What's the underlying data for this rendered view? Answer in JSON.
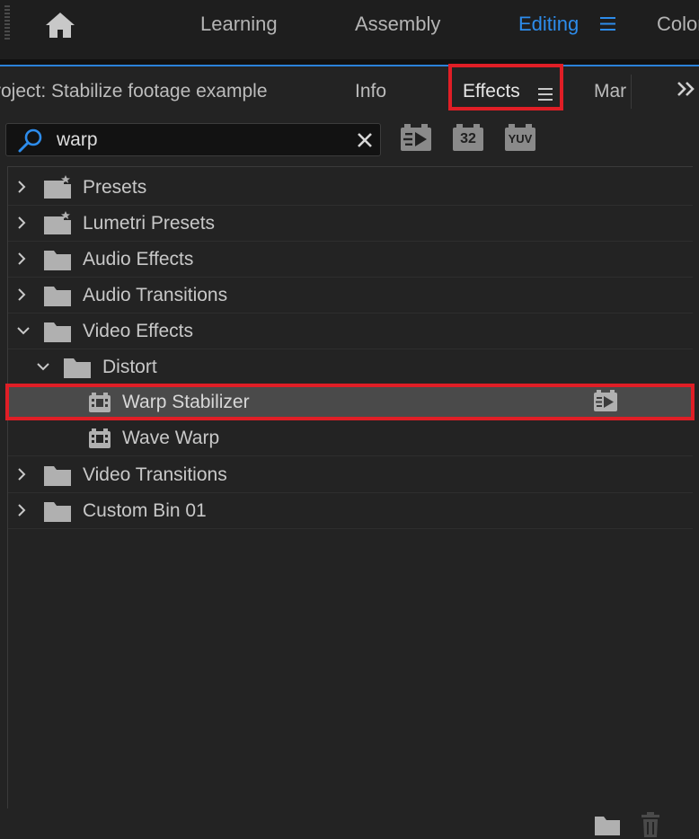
{
  "workspace": {
    "tabs": [
      "Learning",
      "Assembly",
      "Editing",
      "Color"
    ],
    "active": "Editing"
  },
  "panel": {
    "tabs": [
      "roject: Stabilize footage example",
      "Info",
      "Effects",
      "Mar"
    ],
    "active": "Effects"
  },
  "search": {
    "value": "warp",
    "placeholder": ""
  },
  "filters": {
    "accelerated": "",
    "bit32": "32",
    "yuv": "YUV"
  },
  "tree": {
    "presets": "Presets",
    "lumetri_presets": "Lumetri Presets",
    "audio_effects": "Audio Effects",
    "audio_transitions": "Audio Transitions",
    "video_effects": "Video Effects",
    "distort": "Distort",
    "warp_stabilizer": "Warp Stabilizer",
    "wave_warp": "Wave Warp",
    "video_transitions": "Video Transitions",
    "custom_bin": "Custom Bin 01"
  },
  "colors": {
    "accent": "#2d8ceb",
    "highlight": "#e01e26",
    "selected_row": "#4a4a4a"
  },
  "icons": [
    "home-icon",
    "hamburger-icon",
    "double-chevron-icon",
    "search-icon",
    "clear-icon",
    "accelerated-effect-icon",
    "folder-icon",
    "preset-folder-icon",
    "effect-icon",
    "chevron-right-icon",
    "chevron-down-icon",
    "new-bin-icon",
    "trash-icon"
  ]
}
